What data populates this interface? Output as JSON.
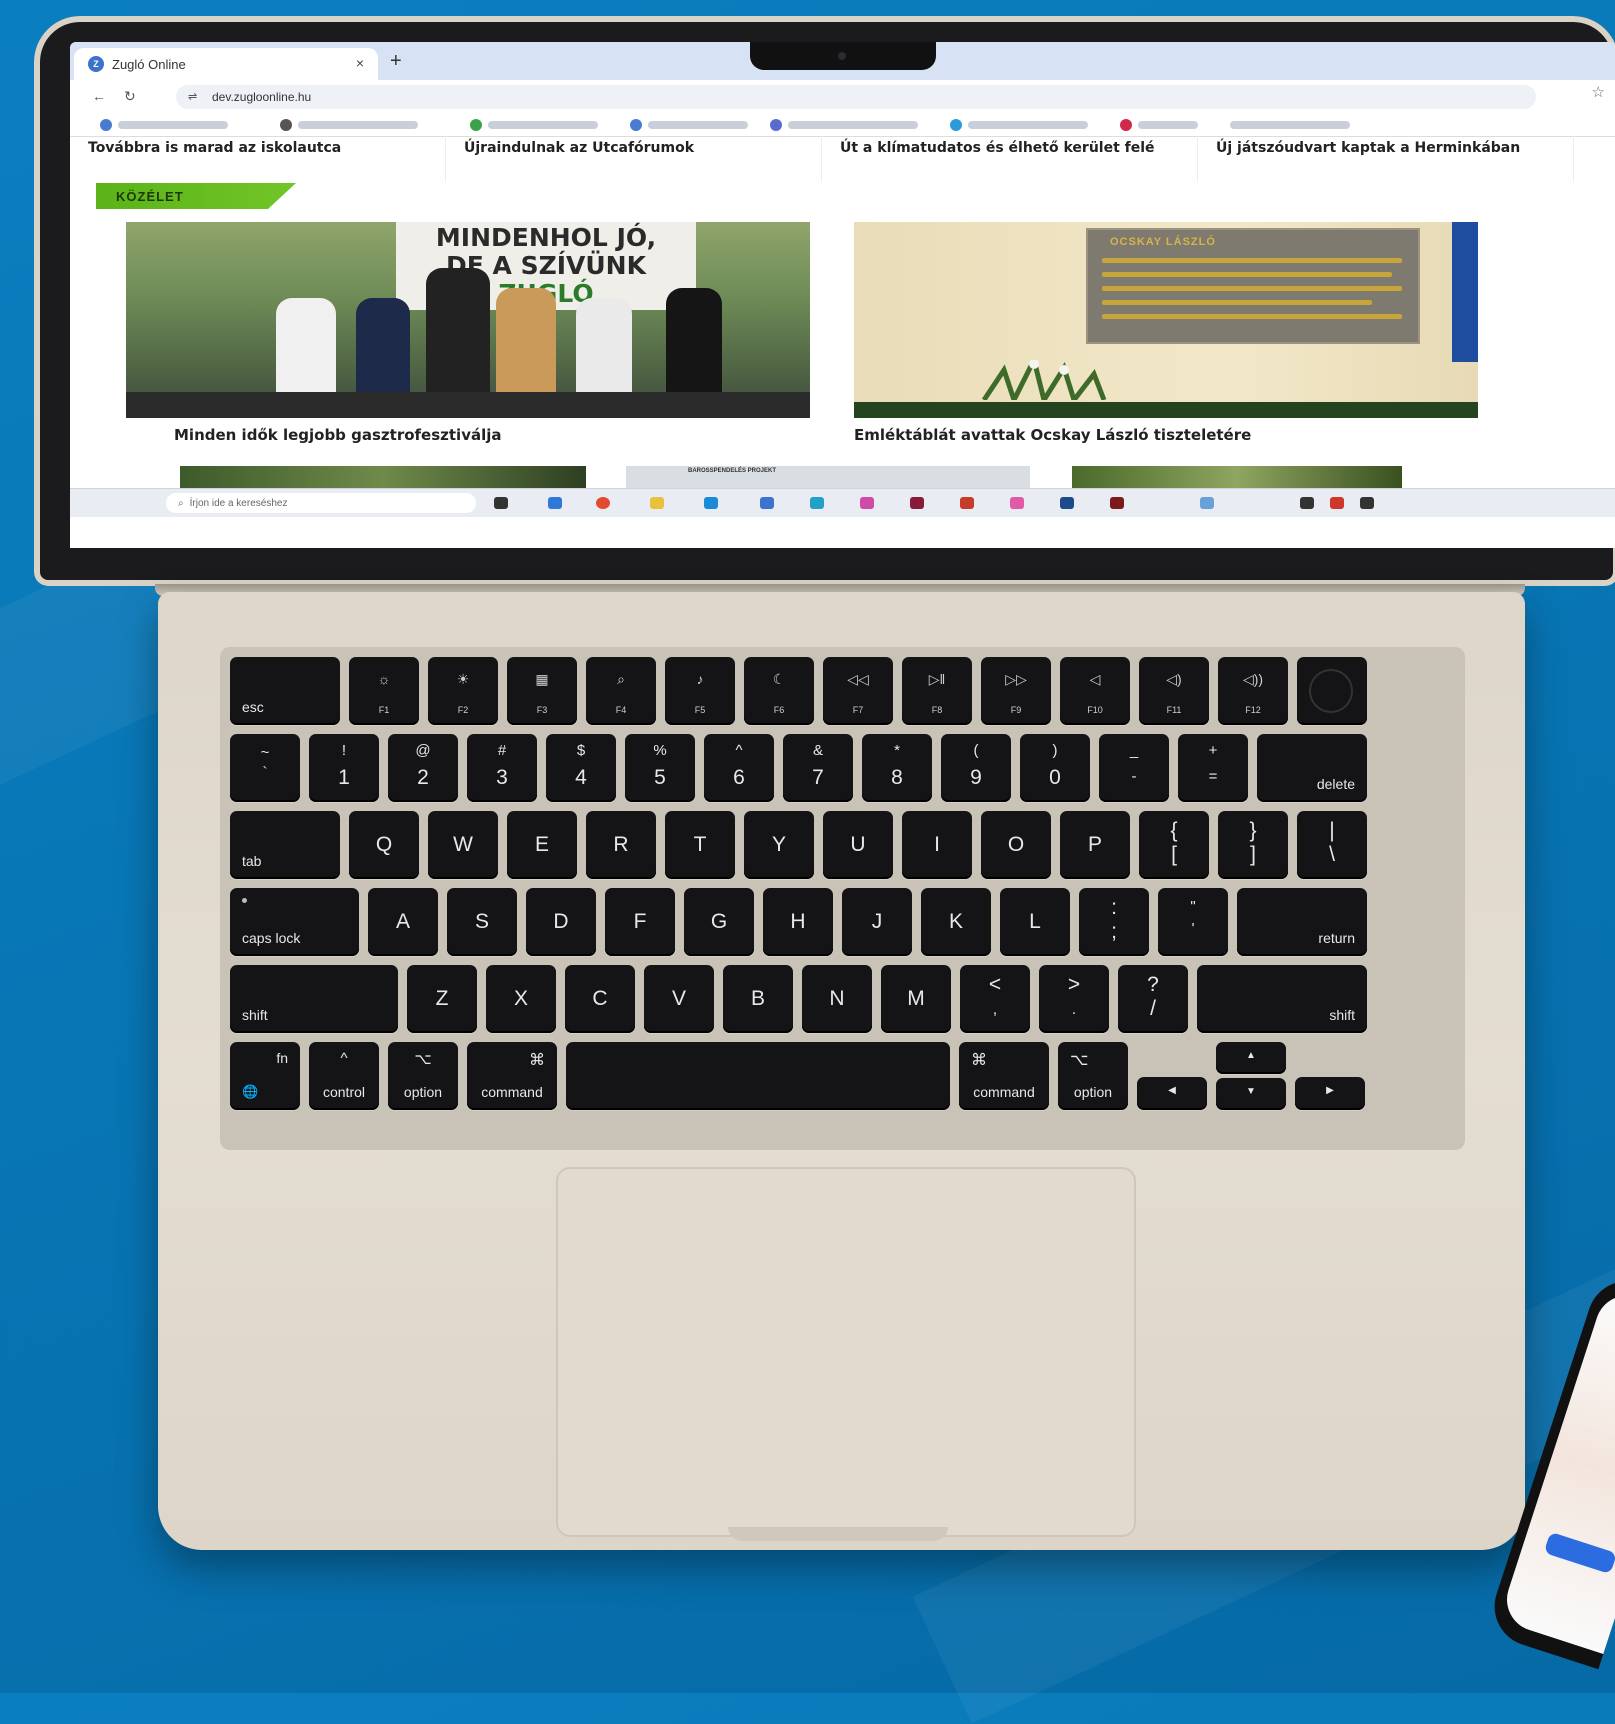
{
  "browser": {
    "tab_title": "Zugló Online",
    "tab_close": "×",
    "new_tab": "+",
    "url": "dev.zugloonline.hu"
  },
  "page": {
    "headlines": [
      "Továbbra is marad az iskolautca",
      "Újraindulnak az Utcafórumok",
      "Út a klímatudatos és élhető kerület felé",
      "Új játszóudvart kaptak a Herminkában"
    ],
    "section_label": "KÖZÉLET",
    "featured": [
      {
        "title": "Minden idők legjobb gasztrofesztiválja",
        "banner_line1": "MINDENHOL JÓ,",
        "banner_line2": "DE A SZÍVÜNK",
        "banner_line3": "ZUGLÓ"
      },
      {
        "title": "Emléktáblát avattak Ocskay László tiszteletére",
        "plaque_heading": "OCSKAY LÁSZLÓ"
      }
    ],
    "thumb_tag": "BAROSSPENDELÉS PROJEKT"
  },
  "taskbar": {
    "search_placeholder": "Írjon ide a kereséshez"
  },
  "keyboard": {
    "fn_row": [
      {
        "icon": "☼",
        "label": "F1"
      },
      {
        "icon": "☀",
        "label": "F2"
      },
      {
        "icon": "▦",
        "label": "F3"
      },
      {
        "icon": "⌕",
        "label": "F4"
      },
      {
        "icon": "♪",
        "label": "F5"
      },
      {
        "icon": "☾",
        "label": "F6"
      },
      {
        "icon": "◁◁",
        "label": "F7"
      },
      {
        "icon": "▷‖",
        "label": "F8"
      },
      {
        "icon": "▷▷",
        "label": "F9"
      },
      {
        "icon": "◁",
        "label": "F10"
      },
      {
        "icon": "◁)",
        "label": "F11"
      },
      {
        "icon": "◁))",
        "label": "F12"
      }
    ],
    "esc": "esc",
    "number_row": [
      {
        "top": "~",
        "bottom": "`"
      },
      {
        "top": "!",
        "bottom": "1"
      },
      {
        "top": "@",
        "bottom": "2"
      },
      {
        "top": "#",
        "bottom": "3"
      },
      {
        "top": "$",
        "bottom": "4"
      },
      {
        "top": "%",
        "bottom": "5"
      },
      {
        "top": "^",
        "bottom": "6"
      },
      {
        "top": "&",
        "bottom": "7"
      },
      {
        "top": "*",
        "bottom": "8"
      },
      {
        "top": "(",
        "bottom": "9"
      },
      {
        "top": ")",
        "bottom": "0"
      },
      {
        "top": "_",
        "bottom": "-"
      },
      {
        "top": "+",
        "bottom": "="
      }
    ],
    "delete": "delete",
    "tab": "tab",
    "qwerty_row": [
      "Q",
      "W",
      "E",
      "R",
      "T",
      "Y",
      "U",
      "I",
      "O",
      "P"
    ],
    "bracket_keys": [
      {
        "top": "{",
        "bottom": "["
      },
      {
        "top": "}",
        "bottom": "]"
      },
      {
        "top": "|",
        "bottom": "\\"
      }
    ],
    "caps_lock": "caps lock",
    "home_row": [
      "A",
      "S",
      "D",
      "F",
      "G",
      "H",
      "J",
      "K",
      "L"
    ],
    "home_punct": [
      {
        "top": ":",
        "bottom": ";"
      },
      {
        "top": "\"",
        "bottom": "'"
      }
    ],
    "return": "return",
    "shift": "shift",
    "bottom_letters": [
      "Z",
      "X",
      "C",
      "V",
      "B",
      "N",
      "M"
    ],
    "bottom_punct": [
      {
        "top": "<",
        "bottom": ","
      },
      {
        "top": ">",
        "bottom": "."
      },
      {
        "top": "?",
        "bottom": "/"
      }
    ],
    "fn": "fn",
    "globe": "🌐",
    "control": "control",
    "control_sym": "^",
    "option": "option",
    "option_sym": "⌥",
    "command": "command",
    "command_sym": "⌘",
    "arrow_up": "▲",
    "arrow_down": "▼",
    "arrow_left": "◀",
    "arrow_right": "▶"
  },
  "colors": {
    "background": "#0a7fc0",
    "section_tag": "#5bb318",
    "laptop_body": "#e0d9cc",
    "key": "#141416"
  }
}
